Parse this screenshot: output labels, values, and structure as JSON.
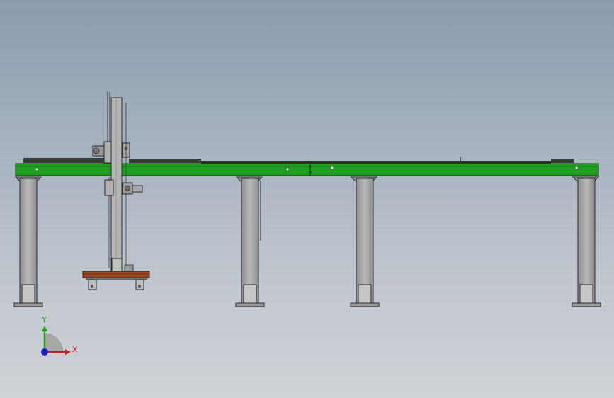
{
  "viewport": {
    "background_top": "#8a9bad",
    "background_bottom": "#cfd2d6"
  },
  "model": {
    "beam_color": "#1f9e1f",
    "beam_edge_color": "#0b3d0b",
    "leg_color": "#a3a3a3",
    "leg_edge_color": "#2d2d2d",
    "rack_color": "#3a3a3a",
    "mast_color": "#b5b5b5",
    "gripper_wood_color": "#9a4a22",
    "support_leg_count": 4
  },
  "triad": {
    "x_label": "X",
    "y_label": "Y",
    "x_color": "#c0201f",
    "y_color": "#1f9e1f",
    "z_color": "#2020c8"
  }
}
